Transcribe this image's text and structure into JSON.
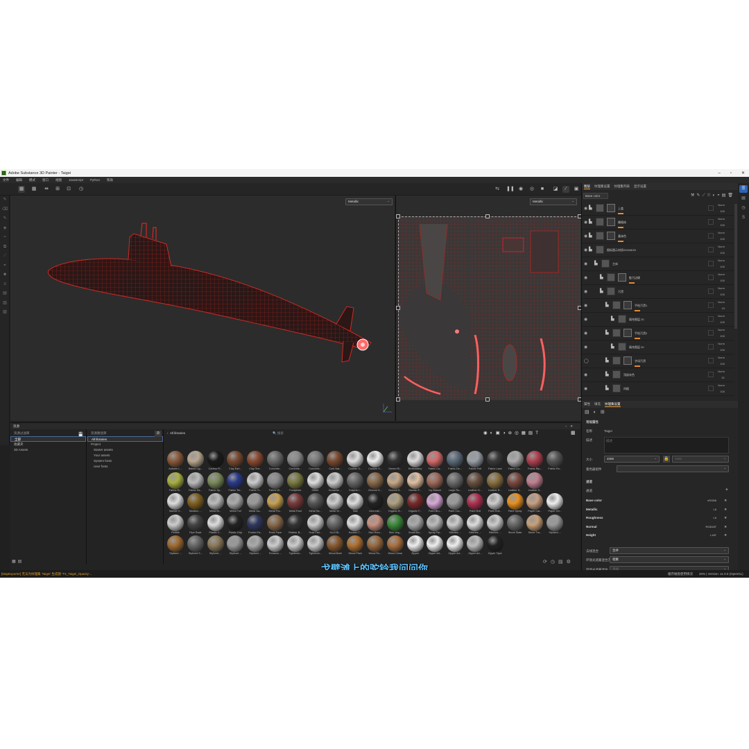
{
  "window": {
    "title": "Adobe Substance 3D Painter - Taigei",
    "logo": "Pt"
  },
  "menu": [
    "文件",
    "编辑",
    "模式",
    "窗口",
    "视图",
    "JavaScript",
    "Python",
    "帮助"
  ],
  "viewport": {
    "left_channel": "Metallic",
    "right_channel": "Metallic"
  },
  "right_panel": {
    "tabs": [
      "图层",
      "纹理集设置",
      "纹理集列表",
      "显示设置"
    ],
    "channel_select": "Base color",
    "layers": [
      {
        "name": "上盖",
        "blend": "Norm",
        "opacity": "100"
      },
      {
        "name": "栅格体",
        "blend": "Norm",
        "opacity": "100"
      },
      {
        "name": "基体色",
        "blend": "Norm",
        "opacity": "100"
      },
      {
        "name": "图标图示材质2024/5/20",
        "blend": "Norm",
        "opacity": "100"
      },
      {
        "name": "主体",
        "blend": "Norm",
        "opacity": "100"
      },
      {
        "name": "脏污边缘",
        "blend": "Norm",
        "opacity": "100"
      },
      {
        "name": "污渍",
        "blend": "Norm",
        "opacity": "100"
      },
      {
        "name": "手绘污渍1",
        "blend": "Norm",
        "opacity": "15"
      },
      {
        "name": "填充图层 20",
        "blend": "Norm",
        "opacity": "100"
      },
      {
        "name": "手绘污渍2",
        "blend": "Norm",
        "opacity": "100"
      },
      {
        "name": "填充图层 20",
        "blend": "Norm",
        "opacity": "100"
      },
      {
        "name": "字母污渍",
        "blend": "Norm",
        "opacity": "100"
      },
      {
        "name": "顶部灰色",
        "blend": "Norm",
        "opacity": "51"
      },
      {
        "name": "凹痕",
        "blend": "Norm",
        "opacity": "100"
      }
    ],
    "props_tabs": [
      "属性",
      "填充",
      "纹理集设置"
    ],
    "section_general": "常规属性",
    "name_label": "名称",
    "name_value": "Taigei",
    "desc_label": "描述",
    "desc_placeholder": "描述",
    "size_label": "大小",
    "size_value": "4096",
    "size_value2": "4096",
    "normal_mix_label": "着色器组件",
    "channels_title": "通道",
    "add_channel_label": "通道",
    "channels": [
      {
        "name": "Base color",
        "format": "sRGB8"
      },
      {
        "name": "Metallic",
        "format": "L8"
      },
      {
        "name": "Roughness",
        "format": "L8"
      },
      {
        "name": "Normal",
        "format": "RGB16F"
      },
      {
        "name": "Height",
        "format": "L16F"
      }
    ],
    "normal_map_label": "法线混合",
    "normal_map_value": "合并",
    "ao_label": "环境光遮蔽混合方法",
    "ao_value": "相乘",
    "bake_label": "环境光遮蔽混合",
    "bake_value": "添加"
  },
  "shelf": {
    "title": "资源",
    "col1_title": "资源过滤库",
    "col1_items": [
      "全部",
      "收藏夹",
      "3D Assets"
    ],
    "col2_title": "资源路径库",
    "col2_items": [
      "All libraries",
      "Project",
      "Starter assets",
      "Your assets",
      "System fonts",
      "User fonts"
    ],
    "breadcrumb": "All libraries",
    "search_placeholder": "搜索",
    "materials": [
      [
        "Autumn L...",
        "Baked Lig...",
        "Carbon Fi...",
        "Clay Eart...",
        "Clay Terr...",
        "Concrete...",
        "Concrete...",
        "Concrete...",
        "Cork Nat...",
        "Custom S...",
        "Custom S...",
        "Denim Ri...",
        "Embroidery",
        "Fabric Ca...",
        "Fabric De...",
        "Fabric Felt",
        "Fabric Lace",
        "Fabric Lin...",
        "Fabric Rip...",
        "Fabric Ro..."
      ],
      [
        "Fabric Ri...",
        "Fabric Sa...",
        "Fabric Sp...",
        "Fabric Ter...",
        "Fabric Tr...",
        "Fabric W...",
        "Footprints",
        "Glitter",
        "Gouache ...",
        "Graphic I...",
        "Ground G...",
        "Ground S...",
        "Human F...",
        "Ivy Branch",
        "Large Ro...",
        "Leather G...",
        "Leather R...",
        "Leather S...",
        "Leather S..."
      ],
      [
        "Marble V...",
        "Medium ...",
        "Metal Br...",
        "Metal Foil",
        "Metal Ga...",
        "Metal Pol...",
        "Metal Rust",
        "Metal Sa...",
        "Metal W...",
        "Nail",
        "new mat...",
        "Organic B...",
        "Organic F...",
        "Paint Bru...",
        "Paint Cra...",
        "Paint Roll",
        "Paint Roll...",
        "Paint Spray",
        "Paper Car...",
        "Paper Gri..."
      ],
      [
        "Pebble",
        "Pipe Rack",
        "Plastic C...",
        "Plastic Grip",
        "Pocket Fa...",
        "Rock Face",
        "Rubber B...",
        "Scar Plai...",
        "Sci-fi Bl...",
        "Scratch T...",
        "Skin Hum...",
        "Skin Veg...",
        "Small Bul...",
        "Spray Pai...",
        "Stitches ...",
        "Stitches ...",
        "Stitches ...",
        "Stone Slate",
        "Stone Tra...",
        "Stylized ..."
      ],
      [
        "Stylized ...",
        "Stylized S...",
        "Stylized ...",
        "Stylized ...",
        "Stylized ...",
        "Terrazzo ...",
        "Tightenin...",
        "Tightenin...",
        "Wood Bark",
        "Wood Plain",
        "Wood Ro...",
        "Wood Close",
        "Zipper",
        "Zipper Ad...",
        "Zipper Ad...",
        "Zipper Ad...",
        "Zipper Tape"
      ]
    ]
  },
  "status": {
    "left": "[MapExporter] 无法为纹理集 'Taigei' 生成图 'TX_Taigei_Opacity'...",
    "right1": "缓存磁盘使用情况",
    "right2": "20% | Version: 11.0.0 (OpenGL)"
  },
  "subtitle": "戈壁滩上的驼铃我问问你"
}
